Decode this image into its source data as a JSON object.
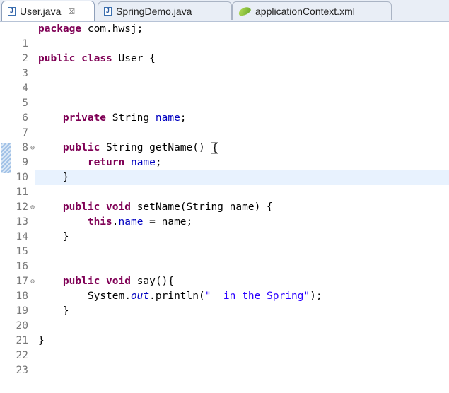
{
  "tabs": [
    {
      "label": "User.java",
      "icon": "java-file-icon",
      "active": true,
      "close": "☒"
    },
    {
      "label": "SpringDemo.java",
      "icon": "java-file-icon",
      "active": false
    },
    {
      "label": "applicationContext.xml",
      "icon": "spring-xml-icon",
      "active": false
    }
  ],
  "editor": {
    "current_line": 11,
    "lines": [
      {
        "n": "1"
      },
      {
        "n": "2"
      },
      {
        "n": "3"
      },
      {
        "n": "4"
      },
      {
        "n": "5"
      },
      {
        "n": "6"
      },
      {
        "n": "7"
      },
      {
        "n": "8"
      },
      {
        "n": "9",
        "fold": "⊖"
      },
      {
        "n": "10"
      },
      {
        "n": "11"
      },
      {
        "n": "12"
      },
      {
        "n": "13",
        "fold": "⊖"
      },
      {
        "n": "14"
      },
      {
        "n": "15"
      },
      {
        "n": "16"
      },
      {
        "n": "17"
      },
      {
        "n": "18",
        "fold": "⊖"
      },
      {
        "n": "19"
      },
      {
        "n": "20"
      },
      {
        "n": "21"
      },
      {
        "n": "22"
      },
      {
        "n": "23"
      }
    ],
    "tokens": {
      "l1_kw": "package",
      "l1_rest": " com.hwsj;",
      "l3_kw1": "public",
      "l3_kw2": "class",
      "l3_rest": " User {",
      "l7_kw": "private",
      "l7_type": " String ",
      "l7_fld": "name",
      "l7_end": ";",
      "l9_kw": "public",
      "l9_rest": " String getName() ",
      "l9_brace": "{",
      "l10_kw": "return",
      "l10_fld": "name",
      "l10_end": ";",
      "l11": "}",
      "l13_kw1": "public",
      "l13_kw2": "void",
      "l13_rest": " setName(String name) {",
      "l14_kw": "this",
      "l14_dot": ".",
      "l14_fld": "name",
      "l14_rest": " = name;",
      "l15": "}",
      "l18_kw1": "public",
      "l18_kw2": "void",
      "l18_rest": " say(){",
      "l19_a": "System.",
      "l19_out": "out",
      "l19_b": ".println(",
      "l19_str": "\"  in the Spring\"",
      "l19_end": ");",
      "l20": "}",
      "l22": "}"
    }
  }
}
